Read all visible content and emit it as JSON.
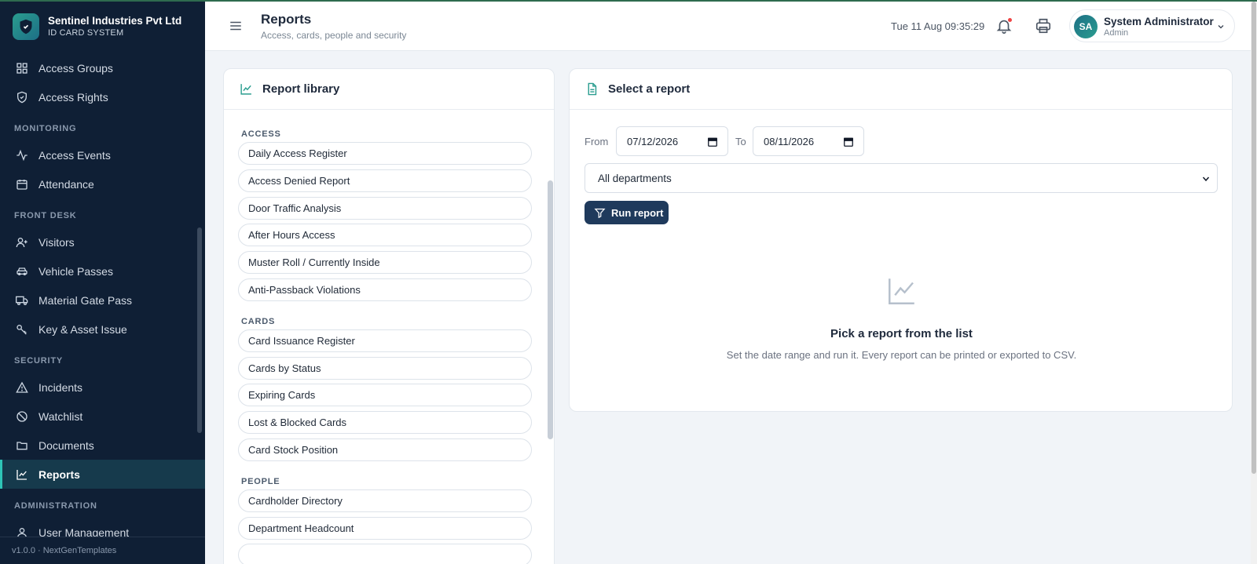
{
  "brand": {
    "name": "Sentinel Industries Pvt Ltd",
    "subtitle": "ID CARD SYSTEM"
  },
  "nav": {
    "items_top": [
      {
        "label": "Access Groups",
        "icon": "grid-icon"
      },
      {
        "label": "Access Rights",
        "icon": "shield-check-icon"
      }
    ],
    "monitoring": {
      "heading": "MONITORING",
      "items": [
        {
          "label": "Access Events",
          "icon": "activity-icon"
        },
        {
          "label": "Attendance",
          "icon": "calendar-icon"
        }
      ]
    },
    "front_desk": {
      "heading": "FRONT DESK",
      "items": [
        {
          "label": "Visitors",
          "icon": "user-plus-icon"
        },
        {
          "label": "Vehicle Passes",
          "icon": "car-icon"
        },
        {
          "label": "Material Gate Pass",
          "icon": "truck-icon"
        },
        {
          "label": "Key & Asset Issue",
          "icon": "key-icon"
        }
      ]
    },
    "security": {
      "heading": "SECURITY",
      "items": [
        {
          "label": "Incidents",
          "icon": "alert-triangle-icon"
        },
        {
          "label": "Watchlist",
          "icon": "ban-icon"
        },
        {
          "label": "Documents",
          "icon": "folder-icon"
        },
        {
          "label": "Reports",
          "icon": "chart-line-icon",
          "active": true
        }
      ]
    },
    "administration": {
      "heading": "ADMINISTRATION",
      "items": [
        {
          "label": "User Management",
          "icon": "user-icon"
        }
      ]
    },
    "version": "v1.0.0 · NextGenTemplates"
  },
  "header": {
    "title": "Reports",
    "subtitle": "Access, cards, people and security",
    "datetime": "Tue 11 Aug 09:35:29",
    "user": {
      "initials": "SA",
      "name": "System Administrator",
      "role": "Admin"
    }
  },
  "library": {
    "title": "Report library",
    "groups": [
      {
        "heading": "ACCESS",
        "items": [
          "Daily Access Register",
          "Access Denied Report",
          "Door Traffic Analysis",
          "After Hours Access",
          "Muster Roll / Currently Inside",
          "Anti-Passback Violations"
        ]
      },
      {
        "heading": "CARDS",
        "items": [
          "Card Issuance Register",
          "Cards by Status",
          "Expiring Cards",
          "Lost & Blocked Cards",
          "Card Stock Position"
        ]
      },
      {
        "heading": "PEOPLE",
        "items": [
          "Cardholder Directory",
          "Department Headcount",
          ""
        ]
      }
    ]
  },
  "select_report": {
    "title": "Select a report",
    "from_label": "From",
    "from_value": "07/12/2026",
    "to_label": "To",
    "to_value": "08/11/2026",
    "department": "All departments",
    "run_label": "Run report",
    "empty_title": "Pick a report from the list",
    "empty_sub": "Set the date range and run it. Every report can be printed or exported to CSV."
  },
  "colors": {
    "sidebar_bg": "#0f1f35",
    "accent": "#2ec4b6",
    "button": "#1f3a5c"
  }
}
